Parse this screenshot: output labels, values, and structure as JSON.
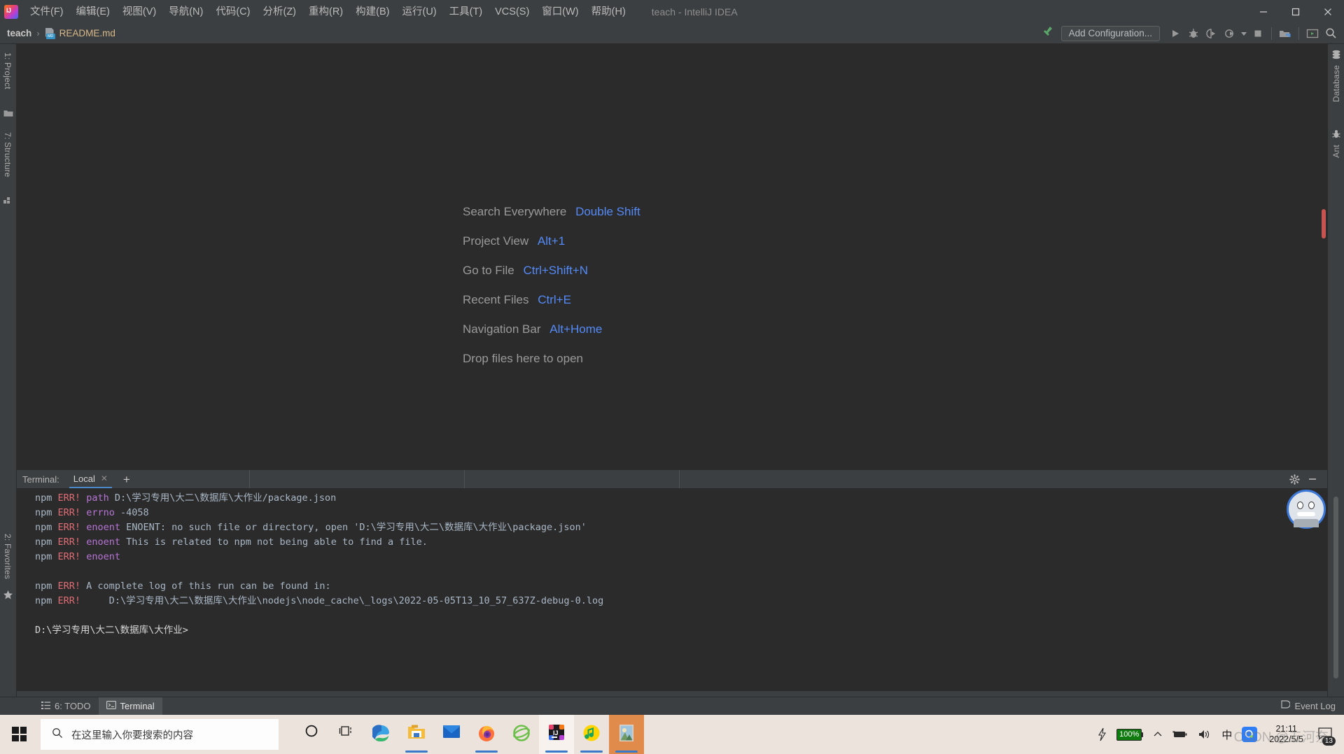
{
  "window": {
    "title": "teach - IntelliJ IDEA",
    "app_logo": "intellij-idea-logo",
    "minimize": "minimize-icon",
    "maximize": "maximize-icon",
    "close": "close-icon"
  },
  "menubar": [
    {
      "label": "文件(F)",
      "mnemonic": "F"
    },
    {
      "label": "编辑(E)",
      "mnemonic": "E"
    },
    {
      "label": "视图(V)",
      "mnemonic": "V"
    },
    {
      "label": "导航(N)",
      "mnemonic": "N"
    },
    {
      "label": "代码(C)",
      "mnemonic": "C"
    },
    {
      "label": "分析(Z)",
      "mnemonic": "Z"
    },
    {
      "label": "重构(R)",
      "mnemonic": "R"
    },
    {
      "label": "构建(B)",
      "mnemonic": "B"
    },
    {
      "label": "运行(U)",
      "mnemonic": "U"
    },
    {
      "label": "工具(T)",
      "mnemonic": "T"
    },
    {
      "label": "VCS(S)",
      "mnemonic": "S"
    },
    {
      "label": "窗口(W)",
      "mnemonic": "W"
    },
    {
      "label": "帮助(H)",
      "mnemonic": "H"
    }
  ],
  "navbar": {
    "project": "teach",
    "separator": "›",
    "file": "README.md",
    "file_icon_badge": "MD"
  },
  "toolbar": {
    "build_icon": "hammer-icon",
    "add_configuration": "Add Configuration...",
    "run_icon": "run-icon",
    "debug_icon": "debug-icon",
    "run_coverage_icon": "run-with-coverage-icon",
    "profile_icon": "profile-icon",
    "profile_dropdown_icon": "chevron-down-icon",
    "stop_icon": "stop-icon",
    "project_structure_icon": "project-structure-icon",
    "updates_icon": "terminal-window-icon",
    "search_icon": "search-icon"
  },
  "left_tool_strip": [
    {
      "label": "1: Project",
      "mnemonic": "1",
      "icon": "folder-icon"
    },
    {
      "label": "7: Structure",
      "mnemonic": "7",
      "icon": "structure-icon"
    },
    {
      "label": "2: Favorites",
      "mnemonic": "2",
      "icon": "star-icon"
    }
  ],
  "right_tool_strip": [
    {
      "label": "Database",
      "icon": "database-icon"
    },
    {
      "label": "Ant",
      "icon": "ant-icon"
    }
  ],
  "editor_hints": {
    "rows": [
      {
        "label": "Search Everywhere",
        "shortcut": "Double Shift"
      },
      {
        "label": "Project View",
        "shortcut": "Alt+1"
      },
      {
        "label": "Go to File",
        "shortcut": "Ctrl+Shift+N"
      },
      {
        "label": "Recent Files",
        "shortcut": "Ctrl+E"
      },
      {
        "label": "Navigation Bar",
        "shortcut": "Alt+Home"
      }
    ],
    "drop_hint": "Drop files here to open",
    "label_color": "#9a9a9a",
    "shortcut_color": "#548af7"
  },
  "terminal": {
    "title": "Terminal:",
    "tab": "Local",
    "tab_close_icon": "close-icon",
    "new_tab_icon": "plus-icon",
    "settings_icon": "gear-icon",
    "hide_icon": "minimize-icon",
    "lines": [
      {
        "prefix": "npm",
        "err": "ERR!",
        "kw": "path",
        "text": " D:\\学习专用\\大二\\数据库\\大作业/package.json"
      },
      {
        "prefix": "npm",
        "err": "ERR!",
        "kw": "errno",
        "text": " -4058"
      },
      {
        "prefix": "npm",
        "err": "ERR!",
        "kw": "enoent",
        "text": " ENOENT: no such file or directory, open 'D:\\学习专用\\大二\\数据库\\大作业\\package.json'"
      },
      {
        "prefix": "npm",
        "err": "ERR!",
        "kw": "enoent",
        "text": " This is related to npm not being able to find a file."
      },
      {
        "prefix": "npm",
        "err": "ERR!",
        "kw": "enoent",
        "text": ""
      },
      {
        "prefix": "",
        "err": "",
        "kw": "",
        "text": ""
      },
      {
        "prefix": "npm",
        "err": "ERR!",
        "kw": "",
        "text": " A complete log of this run can be found in:"
      },
      {
        "prefix": "npm",
        "err": "ERR!",
        "kw": "",
        "text": "     D:\\学习专用\\大二\\数据库\\大作业\\nodejs\\node_cache\\_logs\\2022-05-05T13_10_57_637Z-debug-0.log"
      }
    ],
    "prompt": "D:\\学习专用\\大二\\数据库\\大作业>",
    "colors": {
      "npm": "#a9b7c6",
      "err": "#e06c75",
      "keyword": "#b774d5",
      "text": "#a9b7c6",
      "background": "#2b2b2b"
    }
  },
  "bottom_bar": {
    "tabs": [
      {
        "label": "6: TODO",
        "mnemonic": "6",
        "icon": "todo-list-icon",
        "active": false
      },
      {
        "label": "Terminal",
        "icon": "terminal-icon",
        "active": true
      }
    ],
    "event_log": "Event Log",
    "event_log_icon": "event-log-icon"
  },
  "taskbar": {
    "start_icon": "windows-start-icon",
    "search_placeholder": "在这里输入你要搜索的内容",
    "search_icon": "search-icon",
    "apps": [
      {
        "name": "cortana-icon",
        "running": false
      },
      {
        "name": "task-view-icon",
        "running": false
      },
      {
        "name": "microsoft-edge-icon",
        "running": false
      },
      {
        "name": "file-explorer-icon",
        "running": true
      },
      {
        "name": "mail-icon",
        "running": false
      },
      {
        "name": "firefox-icon",
        "running": true
      },
      {
        "name": "internet-explorer-icon",
        "running": false
      },
      {
        "name": "intellij-idea-icon",
        "running": true
      },
      {
        "name": "qq-music-icon",
        "running": true
      },
      {
        "name": "photos-icon",
        "running": true
      }
    ],
    "tray": {
      "charging_icon": "charging-bolt-icon",
      "battery_percent": "100%",
      "overflow_icon": "chevron-up-icon",
      "battery_icon": "battery-icon",
      "volume_icon": "speaker-icon",
      "ime_icon": "中",
      "search_assistant_icon": "qq-assistant-icon",
      "time": "21:11",
      "date": "2022/5/5",
      "notification_icon": "notification-icon",
      "notification_count": "13"
    },
    "watermark": "CSDN @五河奈",
    "colors": {
      "background": "#ece3dd",
      "running_indicator": "#3a79c9"
    }
  },
  "avatar": {
    "name": "user-avatar"
  }
}
